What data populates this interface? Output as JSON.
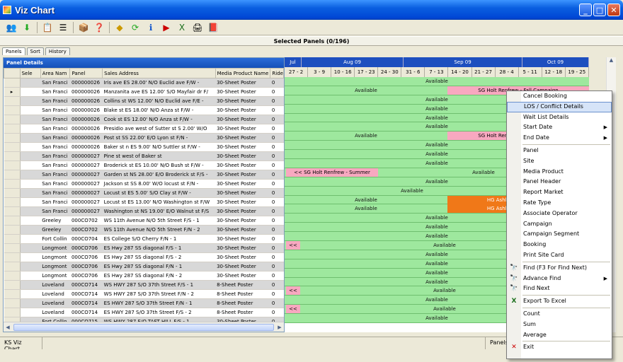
{
  "window": {
    "title": "Viz Chart",
    "minimize": "_",
    "maximize": "□",
    "close": "✕"
  },
  "toolbar_icons": [
    "people-icon",
    "arrow-down-icon",
    "clipboard-icon",
    "list-icon",
    "box-icon",
    "help-file-icon",
    "diamond-arrow-icon",
    "refresh-icon",
    "info-icon",
    "filmstrip-icon",
    "excel-icon",
    "printer-icon",
    "book-icon"
  ],
  "selected_panels": "Selected Panels (0/196)",
  "tabs": [
    "Panels",
    "Sort",
    "History"
  ],
  "panel_details": {
    "title": "Panel Details",
    "columns": [
      "Sele",
      "Area Nam",
      "Panel",
      "Sales Address",
      "Media Product Name",
      "Ride"
    ],
    "rows": [
      [
        "",
        "San Franci",
        "000000026",
        "Iris ave ES 28.00' N/O Euclid ave F/W -",
        "30-Sheet Poster",
        "0"
      ],
      [
        "▸",
        "San Franci",
        "000000026",
        "Manzanita ave ES 12.00' S/O Mayfair dr F/",
        "30-Sheet Poster",
        "0"
      ],
      [
        "",
        "San Franci",
        "000000026",
        "Collins st WS 12.00' N/O Euclid ave F/E -",
        "30-Sheet Poster",
        "0"
      ],
      [
        "",
        "San Franci",
        "000000026",
        "Blake st ES 18.00' N/O Anza st F/W -",
        "30-Sheet Poster",
        "0"
      ],
      [
        "",
        "San Franci",
        "000000026",
        "Cook st ES 12.00' N/O Anza st F/W -",
        "30-Sheet Poster",
        "0"
      ],
      [
        "",
        "San Franci",
        "000000026",
        "Presidio ave west of Sutter st S 2.00' W/O",
        "30-Sheet Poster",
        "0"
      ],
      [
        "",
        "San Franci",
        "000000026",
        "Post st SS 22.00' E/O Lyon st F/N -",
        "30-Sheet Poster",
        "0"
      ],
      [
        "",
        "San Franci",
        "000000026",
        "Baker st n ES 9.00' N/O Suttler st F/W -",
        "30-Sheet Poster",
        "0"
      ],
      [
        "",
        "San Franci",
        "000000027",
        "Pine st west of Baker st",
        "30-Sheet Poster",
        "0"
      ],
      [
        "",
        "San Franci",
        "000000027",
        "Broderick st ES 10.00' N/O Bush st F/W -",
        "30-Sheet Poster",
        "0"
      ],
      [
        "",
        "San Franci",
        "000000027",
        "Garden st NS 28.00' E/O Broderick st F/S -",
        "30-Sheet Poster",
        "0"
      ],
      [
        "",
        "San Franci",
        "000000027",
        "Jackson st SS 8.00' W/O locust st F/N -",
        "30-Sheet Poster",
        "0"
      ],
      [
        "",
        "San Franci",
        "000000027",
        "Locust st ES 5.00' S/O Clay st F/W -",
        "30-Sheet Poster",
        "0"
      ],
      [
        "",
        "San Franci",
        "000000027",
        "Locust st ES 13.00' N/O Washington st F/W",
        "30-Sheet Poster",
        "0"
      ],
      [
        "",
        "San Franci",
        "000000027",
        "Washington st NS 19.00' E/O Walnut st F/S",
        "30-Sheet Poster",
        "0"
      ],
      [
        "",
        "Greeley",
        "000CO702",
        "WS 11th Avenue   N/O 5th Street F/S - 1",
        "30-Sheet Poster",
        "0"
      ],
      [
        "",
        "Greeley",
        "000CO702",
        "WS 11th Avenue   N/O 5th Street F/N - 2",
        "30-Sheet Poster",
        "0"
      ],
      [
        "",
        "Fort Collin",
        "000CO704",
        "ES College   S/O Cherry F/N - 1",
        "30-Sheet Poster",
        "0"
      ],
      [
        "",
        "Longmont",
        "000CO706",
        "ES Hwy 287 SS   diagonal F/S - 1",
        "30-Sheet Poster",
        "0"
      ],
      [
        "",
        "Longmont",
        "000CO706",
        "ES Hwy 287 SS   diagonal F/S - 2",
        "30-Sheet Poster",
        "0"
      ],
      [
        "",
        "Longmont",
        "000CO706",
        "ES Hwy 287 SS   diagonal F/N - 1",
        "30-Sheet Poster",
        "0"
      ],
      [
        "",
        "Longmont",
        "000CO706",
        "ES Hwy 287 SS   diagonal F/N - 2",
        "30-Sheet Poster",
        "0"
      ],
      [
        "",
        "Loveland",
        "000CO714",
        "WS HWY 287   S/O 37th Street F/S - 1",
        "8-Sheet Poster",
        "0"
      ],
      [
        "",
        "Loveland",
        "000CO714",
        "WS HWY 287   S/O 37th Street F/N - 2",
        "8-Sheet Poster",
        "0"
      ],
      [
        "",
        "Loveland",
        "000CO714",
        "ES HWY 287   S/O 37th Street F/N - 1",
        "8-Sheet Poster",
        "0"
      ],
      [
        "",
        "Loveland",
        "000CO714",
        "ES HWY 287   S/O 37th Street F/S - 2",
        "8-Sheet Poster",
        "0"
      ],
      [
        "",
        "Fort Collin",
        "000CO715",
        "WS HWY 287   E/O TAFT HILL F/S - 1",
        "30-Sheet Poster",
        "0"
      ]
    ]
  },
  "timeline": {
    "months": [
      {
        "label": "Jul",
        "w": 24
      },
      {
        "label": "Aug  09",
        "w": 144
      },
      {
        "label": "Sep  09",
        "w": 168
      },
      {
        "label": "Oct  09",
        "w": 94
      }
    ],
    "weeks": [
      "27 - 2",
      "3 - 9",
      "10 - 16",
      "17 - 23",
      "24 - 30",
      "31 - 6",
      "7 - 13",
      "14 - 20",
      "21 - 27",
      "28 - 4",
      "5 - 11",
      "12 - 18",
      "19 - 25"
    ],
    "rows": [
      [
        {
          "t": "Available",
          "c": "label",
          "l": 0,
          "w": 430
        }
      ],
      [
        {
          "t": "Available",
          "c": "label",
          "l": 0,
          "w": 230
        },
        {
          "t": "SG Holt Renfrew - Fall Campaign",
          "c": "pink",
          "l": 230,
          "w": 200
        }
      ],
      [
        {
          "t": "Available",
          "c": "label",
          "l": 0,
          "w": 430
        }
      ],
      [
        {
          "t": "Available",
          "c": "label",
          "l": 0,
          "w": 430
        }
      ],
      [
        {
          "t": "Available",
          "c": "label",
          "l": 0,
          "w": 430
        }
      ],
      [
        {
          "t": "Available",
          "c": "label",
          "l": 0,
          "w": 430
        }
      ],
      [
        {
          "t": "Available",
          "c": "label",
          "l": 0,
          "w": 230
        },
        {
          "t": "SG Holt Renfrew - Fall Campaign",
          "c": "pink",
          "l": 230,
          "w": 200
        }
      ],
      [
        {
          "t": "Available",
          "c": "label",
          "l": 0,
          "w": 430
        }
      ],
      [
        {
          "t": "Available",
          "c": "label",
          "l": 0,
          "w": 430
        }
      ],
      [
        {
          "t": "Available",
          "c": "label",
          "l": 0,
          "w": 430
        }
      ],
      [
        {
          "t": "<< SG Holt Renfrew - Summer",
          "c": "pink",
          "l": 2,
          "w": 130
        },
        {
          "t": "Available",
          "c": "label",
          "l": 132,
          "w": 298
        }
      ],
      [
        {
          "t": "Available",
          "c": "label",
          "l": 0,
          "w": 430
        }
      ],
      [
        {
          "t": "Available",
          "c": "label",
          "l": 0,
          "w": 360
        }
      ],
      [
        {
          "t": "Available",
          "c": "label",
          "l": 0,
          "w": 230
        },
        {
          "t": "HG Ashley Furniture - Fall",
          "c": "orange",
          "l": 230,
          "w": 200
        }
      ],
      [
        {
          "t": "Available",
          "c": "label",
          "l": 0,
          "w": 230
        },
        {
          "t": "HG Ashley Furniture - Fall",
          "c": "orange",
          "l": 230,
          "w": 200
        }
      ],
      [
        {
          "t": "Available",
          "c": "label",
          "l": 0,
          "w": 430
        }
      ],
      [
        {
          "t": "Available",
          "c": "label",
          "l": 0,
          "w": 430
        }
      ],
      [
        {
          "t": "Available",
          "c": "label",
          "l": 0,
          "w": 430
        }
      ],
      [
        {
          "t": "<<",
          "c": "pink",
          "l": 2,
          "w": 20
        },
        {
          "t": "Available",
          "c": "label",
          "l": 22,
          "w": 408
        }
      ],
      [
        {
          "t": "Available",
          "c": "label",
          "l": 0,
          "w": 430
        }
      ],
      [
        {
          "t": "Available",
          "c": "label",
          "l": 0,
          "w": 430
        }
      ],
      [
        {
          "t": "Available",
          "c": "label",
          "l": 0,
          "w": 430
        }
      ],
      [
        {
          "t": "Available",
          "c": "label",
          "l": 0,
          "w": 430
        }
      ],
      [
        {
          "t": "<<",
          "c": "pink",
          "l": 2,
          "w": 20
        },
        {
          "t": "Available",
          "c": "label",
          "l": 22,
          "w": 408
        }
      ],
      [
        {
          "t": "Available",
          "c": "label",
          "l": 0,
          "w": 430
        }
      ],
      [
        {
          "t": "<<",
          "c": "pink",
          "l": 2,
          "w": 20
        },
        {
          "t": "Available",
          "c": "label",
          "l": 22,
          "w": 408
        }
      ],
      [
        {
          "t": "Available",
          "c": "label",
          "l": 0,
          "w": 430
        }
      ]
    ]
  },
  "status": [
    "KS Viz Chart",
    "",
    "Panels"
  ],
  "context_menu": [
    {
      "label": "Cancel Booking"
    },
    {
      "label": "LOS / Conflict Details",
      "hl": true
    },
    {
      "label": "Wait List Details"
    },
    {
      "label": "Start Date",
      "sub": true
    },
    {
      "label": "End Date",
      "sub": true
    },
    {
      "sep": true
    },
    {
      "label": "Panel"
    },
    {
      "label": "Site"
    },
    {
      "label": "Media Product"
    },
    {
      "label": "Panel Header"
    },
    {
      "label": "Report Market"
    },
    {
      "label": "Rate Type"
    },
    {
      "label": "Associate Operator"
    },
    {
      "label": "Campaign"
    },
    {
      "label": "Campaign Segment"
    },
    {
      "label": "Booking"
    },
    {
      "label": "Print Site Card"
    },
    {
      "sep": true
    },
    {
      "label": "Find (F3 For Find Next)",
      "icon": "🔭"
    },
    {
      "label": "Advance Find",
      "icon": "🔭",
      "sub": true
    },
    {
      "label": "Find Next",
      "icon": "🔭"
    },
    {
      "sep": true
    },
    {
      "label": "Export To Excel",
      "icon": "X"
    },
    {
      "sep": true
    },
    {
      "label": "Count"
    },
    {
      "label": "Sum"
    },
    {
      "label": "Average"
    },
    {
      "sep": true
    },
    {
      "label": "Exit",
      "icon": "✕"
    }
  ]
}
